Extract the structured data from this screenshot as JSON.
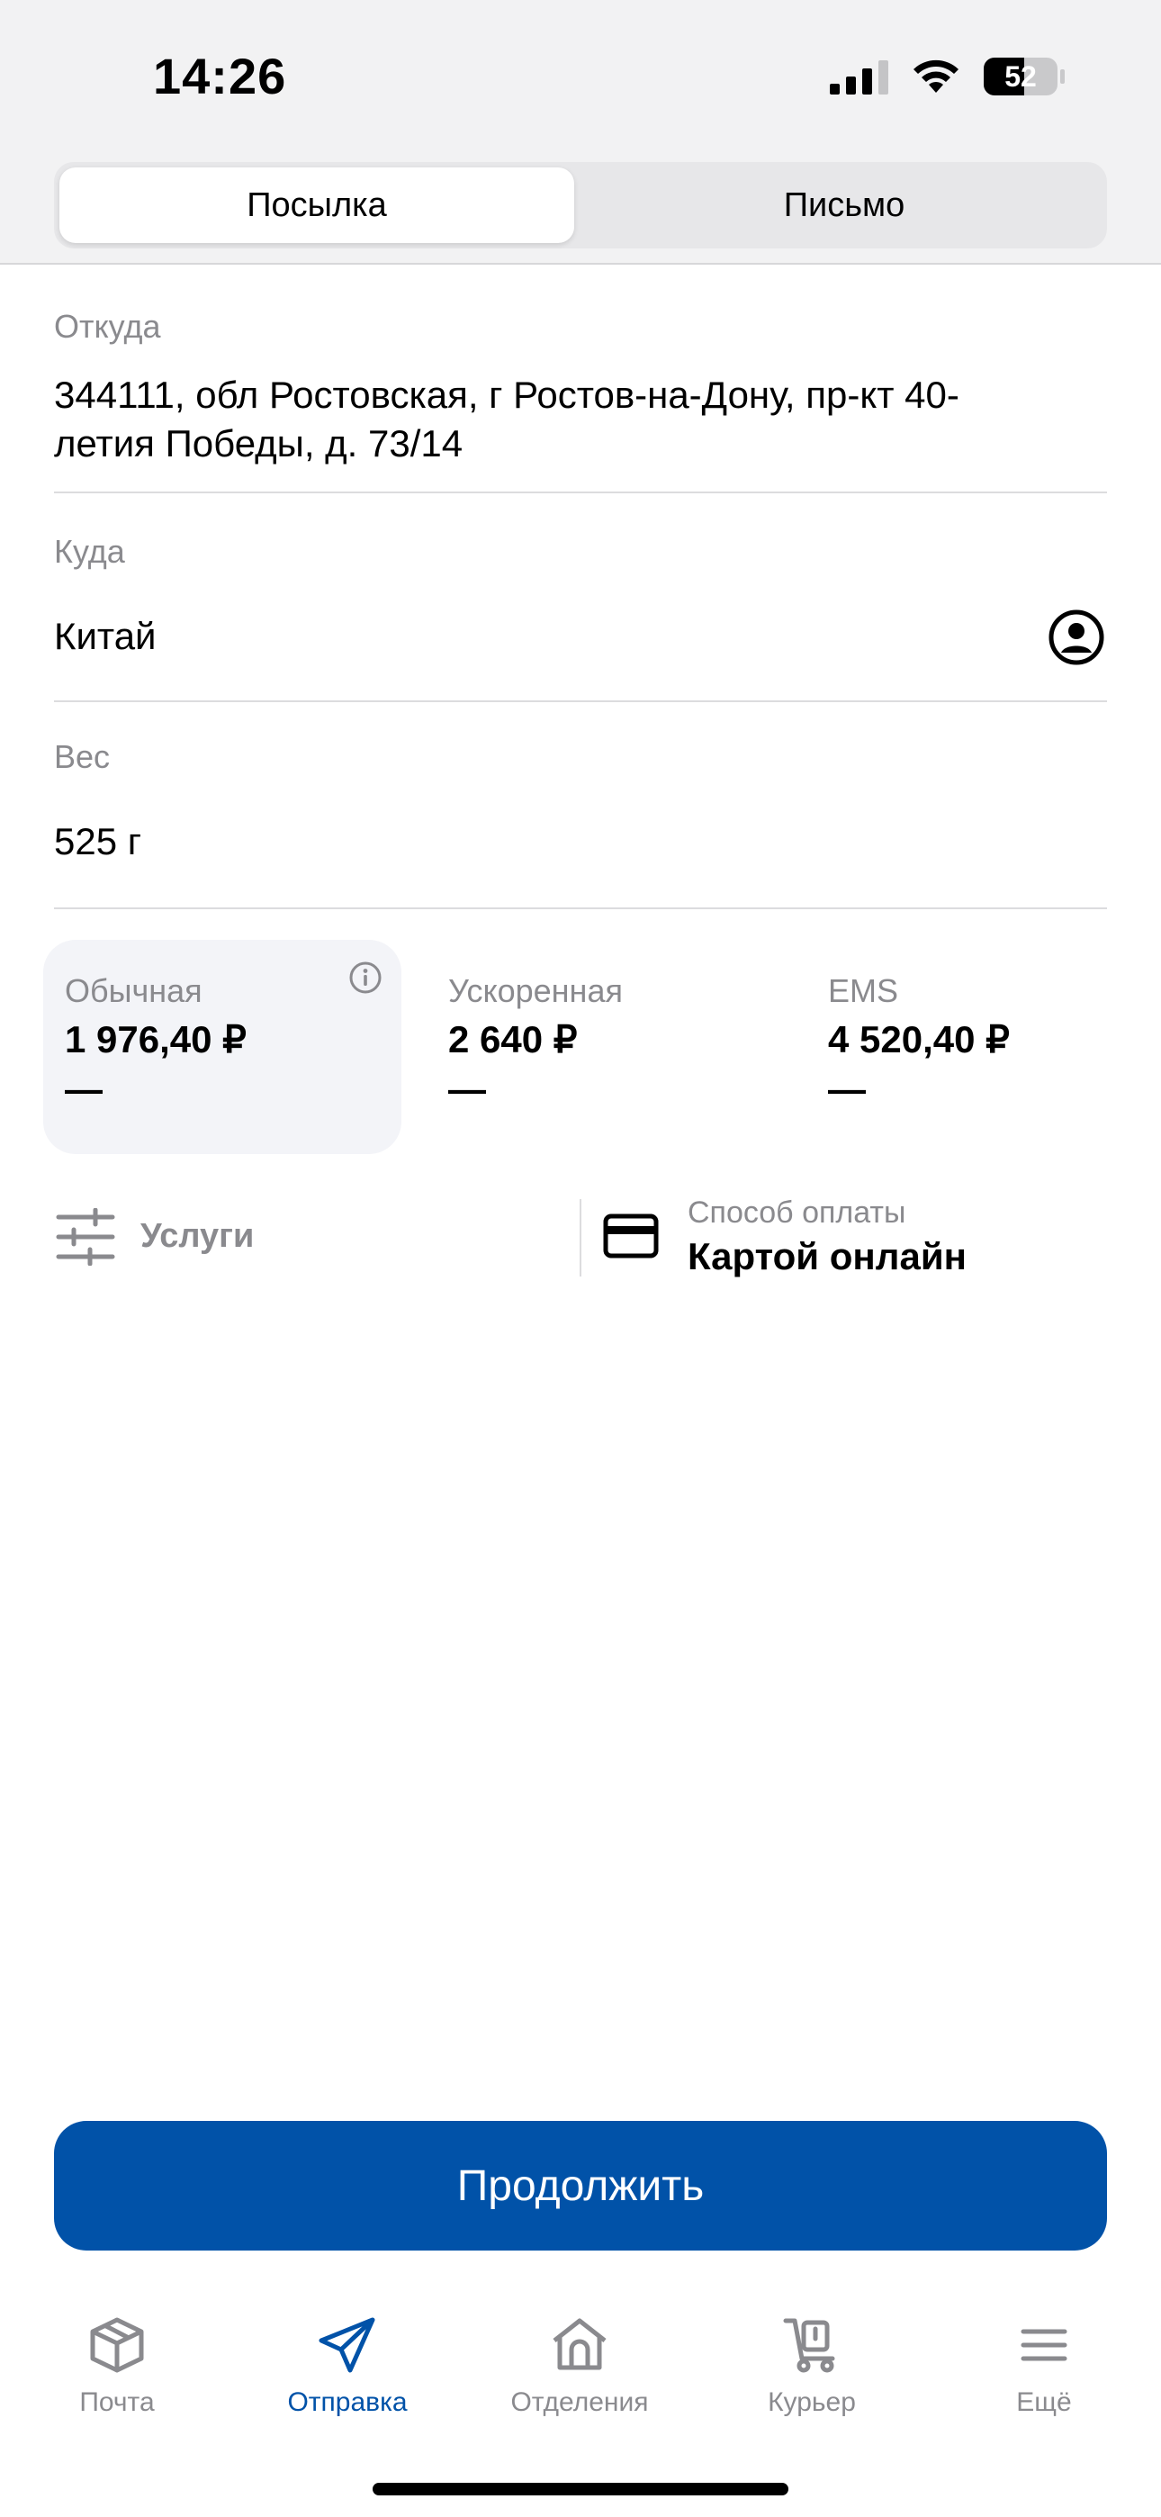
{
  "status": {
    "time": "14:26",
    "battery": "52"
  },
  "tabs_top": {
    "parcel": "Посылка",
    "letter": "Письмо"
  },
  "from": {
    "label": "Откуда",
    "value_line1": "344111, обл Ростовская, г Ростов-на-Дону, пр-кт 40-",
    "value_line2": "летия Победы, д. 73/14"
  },
  "to": {
    "label": "Куда",
    "value": "Китай"
  },
  "weight": {
    "label": "Вес",
    "value": "525 г"
  },
  "rates": [
    {
      "name": "Обычная",
      "price": "1 976,40 ₽",
      "term": "—"
    },
    {
      "name": "Ускоренная",
      "price": "2 640 ₽",
      "term": "—"
    },
    {
      "name": "EMS",
      "price": "4 520,40 ₽",
      "term": "—"
    }
  ],
  "services": {
    "label": "Услуги"
  },
  "payment": {
    "label": "Способ оплаты",
    "value": "Картой онлайн"
  },
  "cta": {
    "label": "Продолжить"
  },
  "bottom_tabs": [
    {
      "label": "Почта",
      "icon": "package-icon"
    },
    {
      "label": "Отправка",
      "icon": "paper-plane-icon"
    },
    {
      "label": "Отделения",
      "icon": "post-office-icon"
    },
    {
      "label": "Курьер",
      "icon": "courier-cart-icon"
    },
    {
      "label": "Ещё",
      "icon": "menu-icon"
    }
  ],
  "colors": {
    "accent": "#0152a8",
    "muted": "#8a8a8e",
    "selected_bg": "#f3f4f8"
  }
}
